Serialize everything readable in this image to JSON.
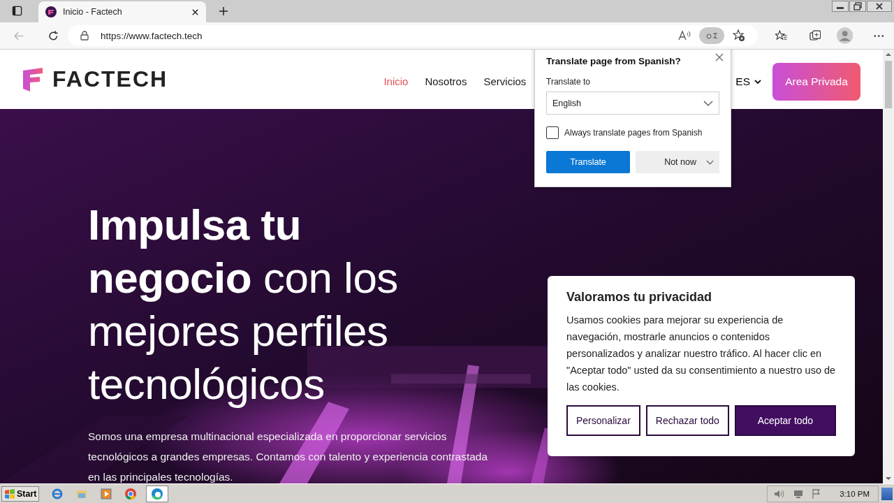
{
  "browser": {
    "tab_title": "Inicio - Factech",
    "url": "https://www.factech.tech"
  },
  "site": {
    "logo": "FACTECH",
    "nav": [
      {
        "label": "Inicio",
        "selected": true
      },
      {
        "label": "Nosotros",
        "selected": false
      },
      {
        "label": "Servicios",
        "selected": false
      }
    ],
    "language": "ES",
    "cta": "Area Privada"
  },
  "hero": {
    "kind": "picture",
    "heading": "**Impulsa tu negocio** con los mejores perfiles tecnológicos",
    "text": "Somos una empresa multinacional especializada en proporcionar servicios tecnológicos a grandes empresas. Contamos con talento y experiencia contrastada en las principales tecnologías."
  },
  "translate_popup": {
    "title": "Translate page from Spanish?",
    "label": "Translate to",
    "language": "English",
    "always_label": "Always translate pages from Spanish",
    "always_checked": false,
    "primary": "Translate",
    "secondary": "Not now"
  },
  "cookie_banner": {
    "title": "Valoramos tu privacidad",
    "text": "Usamos cookies para mejorar su experiencia de navegación, mostrarle anuncios o contenidos personalizados y analizar nuestro tráfico. Al hacer clic en \"Aceptar todo\" usted da su consentimiento a nuestro uso de las cookies.",
    "buttons": [
      {
        "label": "Personalizar",
        "kind": "outline"
      },
      {
        "label": "Rechazar todo",
        "kind": "outline"
      },
      {
        "label": "Aceptar todo",
        "kind": "filled"
      }
    ]
  },
  "taskbar": {
    "start": "Start",
    "clock": "3:10 PM"
  }
}
